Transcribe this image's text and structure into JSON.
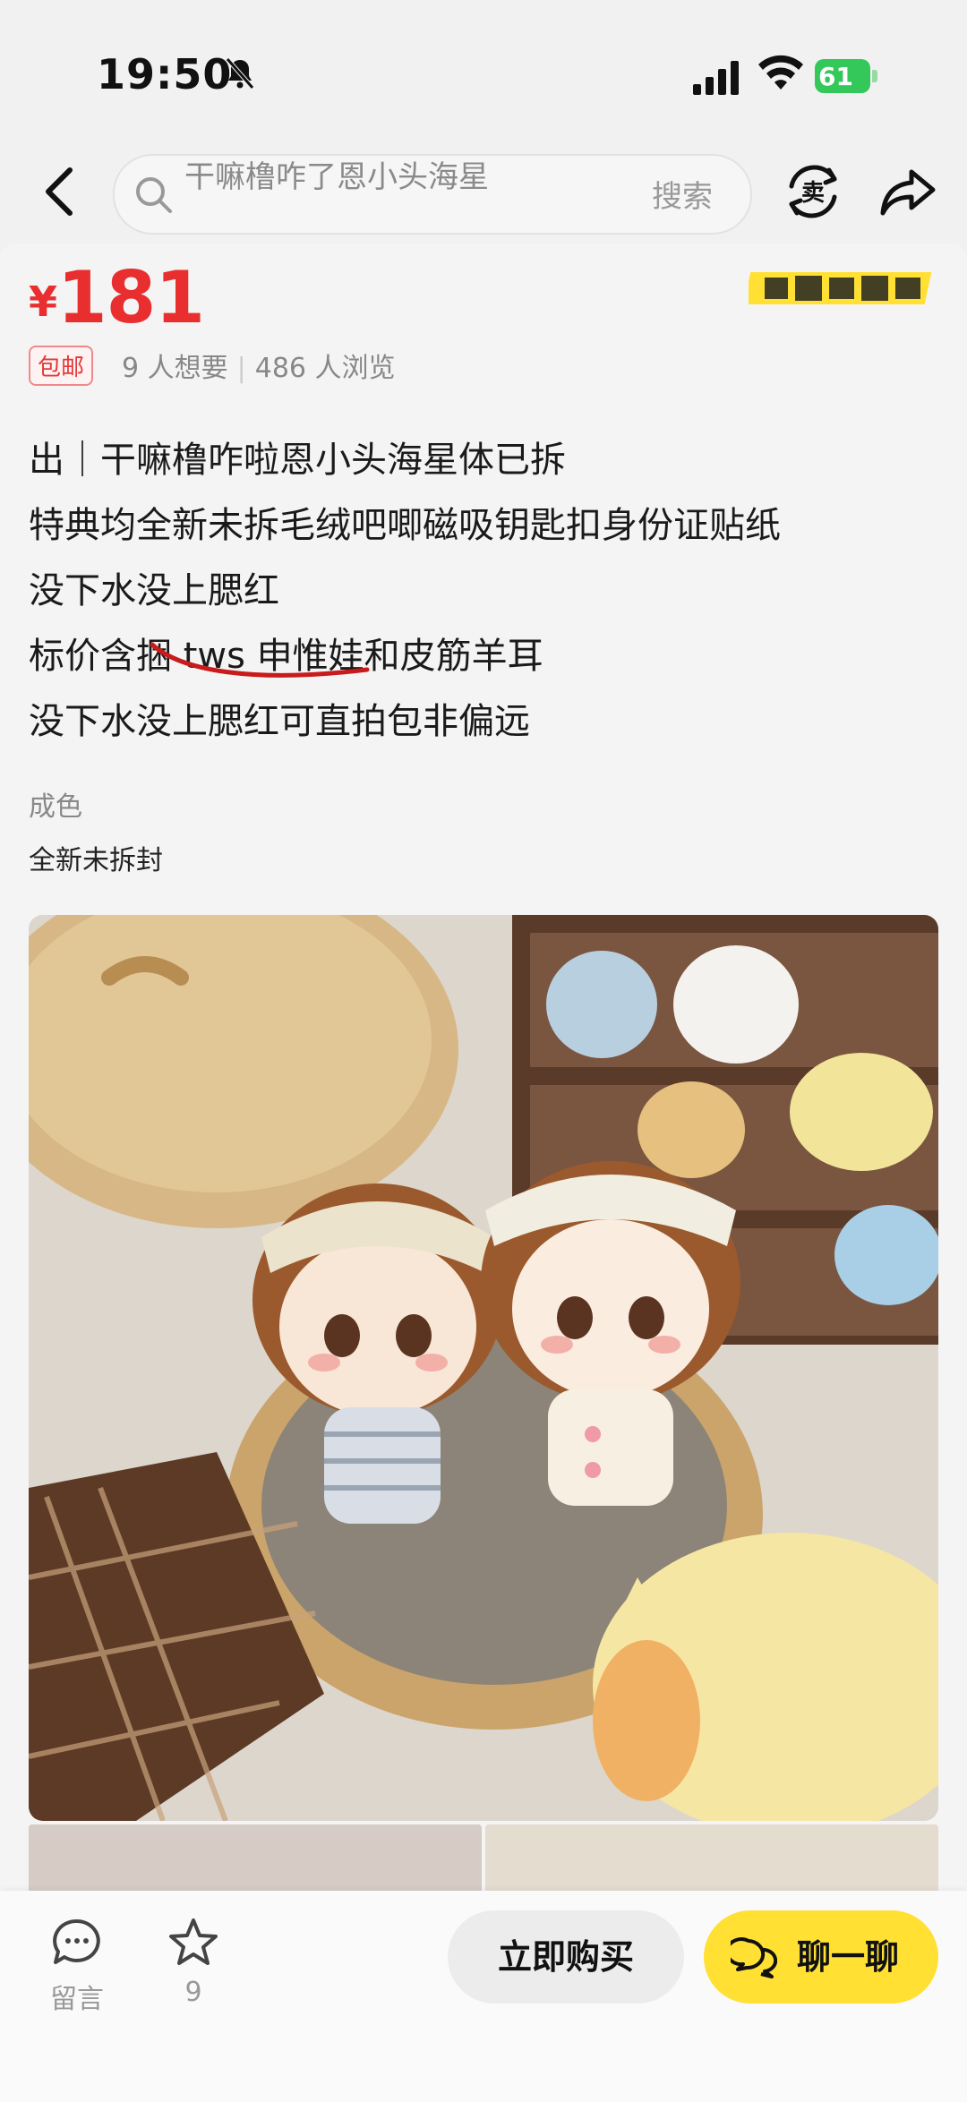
{
  "status_bar": {
    "time": "19:50",
    "battery": "61"
  },
  "search": {
    "hint_line1": "干嘛橹咋了恩小头海星",
    "hint_line2": "干嘛橹咋了恩",
    "button_label": "搜索"
  },
  "listing": {
    "currency": "¥",
    "price": "181",
    "tag": "包邮",
    "wants": "9 人想要",
    "views": "486 人浏览",
    "description_lines": [
      "出｜干嘛橹咋啦恩小头海星体已拆",
      "特典均全新未拆毛绒吧唧磁吸钥匙扣身份证贴纸",
      " 没下水没上腮红",
      "标价含捆 tws 申惟娃和皮筋羊耳",
      "没下水没上腮红可直拍包非偏远"
    ],
    "condition_label": "成色",
    "condition_value": "全新未拆封"
  },
  "bottom_bar": {
    "comment_label": "留言",
    "favorite_count": "9",
    "buy_label": "立即购买",
    "chat_label": "聊一聊"
  },
  "colors": {
    "price_red": "#e82e2e",
    "chat_yellow": "#ffe033",
    "battery_green": "#34c759"
  }
}
